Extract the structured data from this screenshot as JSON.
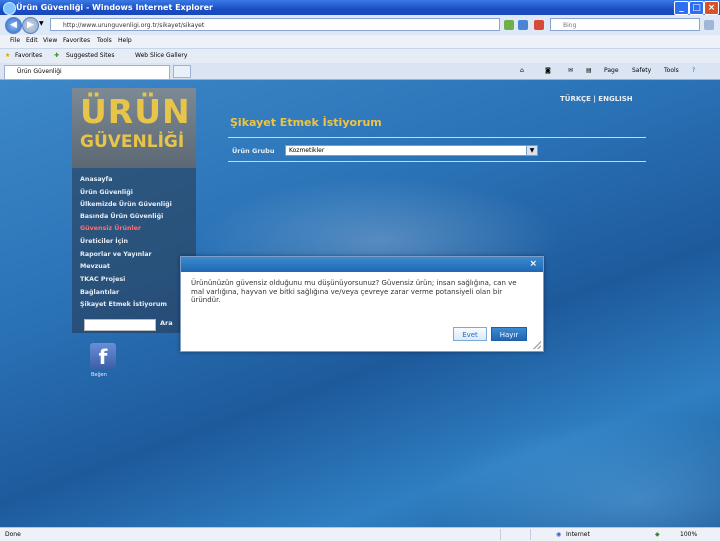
{
  "window": {
    "title": "Ürün Güvenliği - Windows Internet Explorer",
    "controls": [
      "_",
      "□",
      "×"
    ]
  },
  "address_bar": {
    "url": "http://www.urunguvenligi.org.tr/sikayet/sikayet",
    "search_placeholder": "Bing"
  },
  "menu": [
    "File",
    "Edit",
    "View",
    "Favorites",
    "Tools",
    "Help"
  ],
  "favorites_bar": {
    "favorites_label": "Favorites",
    "items": [
      "Suggested Sites",
      "Web Slice Gallery"
    ]
  },
  "tab": {
    "label": "Ürün Güvenliği"
  },
  "toolbar_right": [
    "Page",
    "Safety",
    "Tools"
  ],
  "site": {
    "logo_line1": "ÜRÜN",
    "logo_line2": "GÜVENLİĞİ",
    "languages": "TÜRKÇE | ENGLISH",
    "nav": [
      "Anasayfa",
      "Ürün Güvenliği",
      "Ülkemizde Ürün Güvenliği",
      "Basında Ürün Güvenliği",
      "Güvensiz Ürünler",
      "Üreticiler İçin",
      "Raporlar ve Yayınlar",
      "Mevzuat",
      "TKAC Projesi",
      "Bağlantılar",
      "Şikayet Etmek İstiyorum"
    ],
    "active_nav_index": 4,
    "search_button": "Ara",
    "facebook_label": "Beğen",
    "page_title": "Şikayet Etmek İstiyorum",
    "group_label": "Ürün Grubu",
    "group_value": "Kozmetikler"
  },
  "modal": {
    "message": "Ürününüzün güvensiz olduğunu mu düşünüyorsunuz? Güvensiz ürün; insan sağlığına, can ve mal varlığına, hayvan ve bitki sağlığına ve/veya çevreye zarar verme potansiyeli olan bir üründür.",
    "yes_label": "Evet",
    "no_label": "Hayır",
    "close_glyph": "×"
  },
  "status_bar": {
    "left": "Done",
    "zone": "Internet",
    "zoom": "100%"
  }
}
